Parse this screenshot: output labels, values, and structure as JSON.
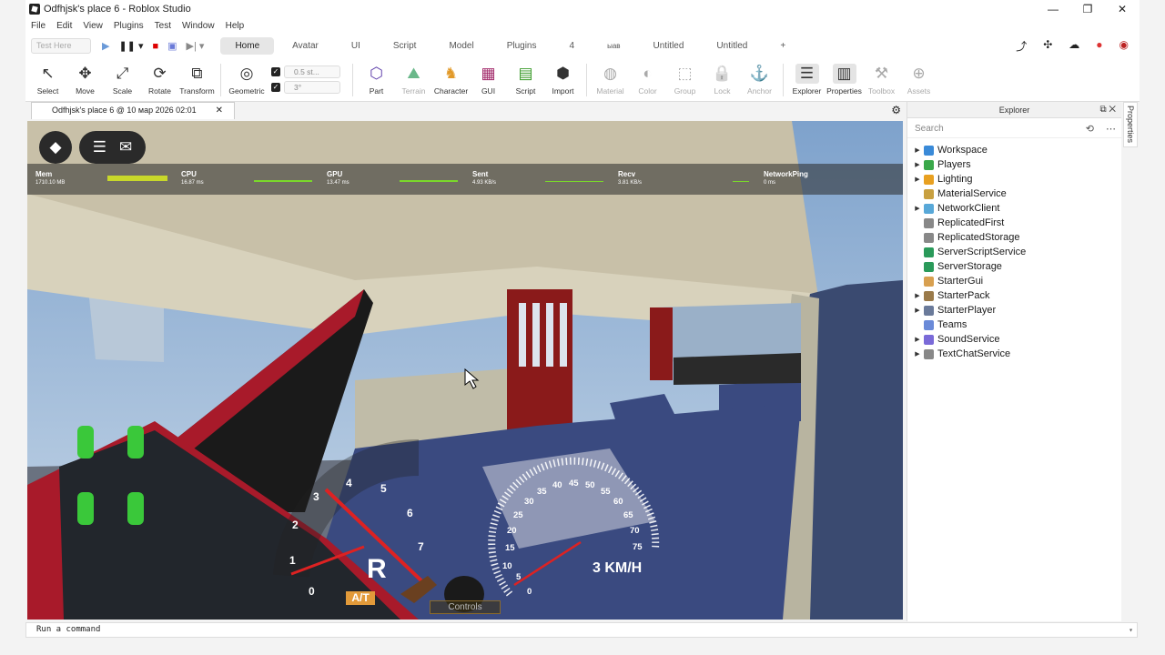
{
  "window": {
    "title": "Odfhjsk's place 6 - Roblox Studio",
    "controls": [
      "—",
      "❐",
      "✕"
    ]
  },
  "menu": [
    "File",
    "Edit",
    "View",
    "Plugins",
    "Test",
    "Window",
    "Help"
  ],
  "ribbon_tabs": {
    "test_here": "Test Here",
    "tabs": [
      "Home",
      "Avatar",
      "UI",
      "Script",
      "Model",
      "Plugins",
      "4",
      "ыав",
      "Untitled",
      "Untitled",
      "+"
    ],
    "active": "Home"
  },
  "toolbar": {
    "tools": [
      {
        "name": "select",
        "label": "Select",
        "icon": "↖"
      },
      {
        "name": "move",
        "label": "Move",
        "icon": "✥"
      },
      {
        "name": "scale",
        "label": "Scale",
        "icon": "⤢"
      },
      {
        "name": "rotate",
        "label": "Rotate",
        "icon": "⟳"
      },
      {
        "name": "transform",
        "label": "Transform",
        "icon": "⧉"
      },
      {
        "name": "geometric",
        "label": "Geometric",
        "icon": "◎"
      }
    ],
    "snap_move": "0.5 st...",
    "snap_rotate": "3°",
    "tools2": [
      {
        "name": "part",
        "label": "Part",
        "icon": "⬡"
      },
      {
        "name": "terrain",
        "label": "Terrain",
        "icon": "⛰"
      },
      {
        "name": "character",
        "label": "Character",
        "icon": "♞"
      },
      {
        "name": "gui",
        "label": "GUI",
        "icon": "▦"
      },
      {
        "name": "script",
        "label": "Script",
        "icon": "▤"
      },
      {
        "name": "import",
        "label": "Import",
        "icon": "⬢"
      },
      {
        "name": "material",
        "label": "Material",
        "icon": "◍"
      },
      {
        "name": "color",
        "label": "Color",
        "icon": "◐"
      },
      {
        "name": "group",
        "label": "Group",
        "icon": "⬚"
      },
      {
        "name": "lock",
        "label": "Lock",
        "icon": "🔒"
      },
      {
        "name": "anchor",
        "label": "Anchor",
        "icon": "⚓"
      },
      {
        "name": "explorer",
        "label": "Explorer",
        "icon": "☰"
      },
      {
        "name": "properties",
        "label": "Properties",
        "icon": "▥"
      },
      {
        "name": "toolbox",
        "label": "Toolbox",
        "icon": "⚒"
      },
      {
        "name": "assets",
        "label": "Assets",
        "icon": "⊕"
      }
    ]
  },
  "document_tab": "Odfhjsk's place 6 @ 10 мар 2026 02:01",
  "stats": [
    {
      "name": "Mem",
      "value": "1710.10 MB"
    },
    {
      "name": "CPU",
      "value": "16.87 ms"
    },
    {
      "name": "GPU",
      "value": "13.47 ms"
    },
    {
      "name": "Sent",
      "value": "4.93 KB/s"
    },
    {
      "name": "Recv",
      "value": "3.81 KB/s"
    },
    {
      "name": "NetworkPing",
      "value": "0 ms"
    }
  ],
  "hud": {
    "gear": "R",
    "transmission": "A/T",
    "speed": "3 KM/H",
    "controls": "Controls",
    "tach_labels": [
      "0",
      "1",
      "2",
      "3",
      "4",
      "5",
      "6",
      "7"
    ],
    "speedo_labels": [
      "0",
      "5",
      "10",
      "15",
      "20",
      "25",
      "30",
      "35",
      "40",
      "45",
      "50",
      "55",
      "60",
      "65",
      "70",
      "75"
    ]
  },
  "explorer": {
    "title": "Explorer",
    "search_placeholder": "Search",
    "items": [
      {
        "label": "Workspace",
        "expandable": true,
        "color": "#3a8ad8"
      },
      {
        "label": "Players",
        "expandable": true,
        "color": "#3aa84a"
      },
      {
        "label": "Lighting",
        "expandable": true,
        "color": "#e8a020"
      },
      {
        "label": "MaterialService",
        "expandable": false,
        "color": "#c8a040"
      },
      {
        "label": "NetworkClient",
        "expandable": true,
        "color": "#58a8d8"
      },
      {
        "label": "ReplicatedFirst",
        "expandable": false,
        "color": "#888888"
      },
      {
        "label": "ReplicatedStorage",
        "expandable": false,
        "color": "#888888"
      },
      {
        "label": "ServerScriptService",
        "expandable": false,
        "color": "#2a9a5a"
      },
      {
        "label": "ServerStorage",
        "expandable": false,
        "color": "#2a9a5a"
      },
      {
        "label": "StarterGui",
        "expandable": false,
        "color": "#d8a050"
      },
      {
        "label": "StarterPack",
        "expandable": true,
        "color": "#9a7a4a"
      },
      {
        "label": "StarterPlayer",
        "expandable": true,
        "color": "#6a7a9a"
      },
      {
        "label": "Teams",
        "expandable": false,
        "color": "#6a8ad8"
      },
      {
        "label": "SoundService",
        "expandable": true,
        "color": "#7a6ad8"
      },
      {
        "label": "TextChatService",
        "expandable": true,
        "color": "#888888"
      }
    ]
  },
  "side_tab": "Properties",
  "command_bar": "Run a command"
}
